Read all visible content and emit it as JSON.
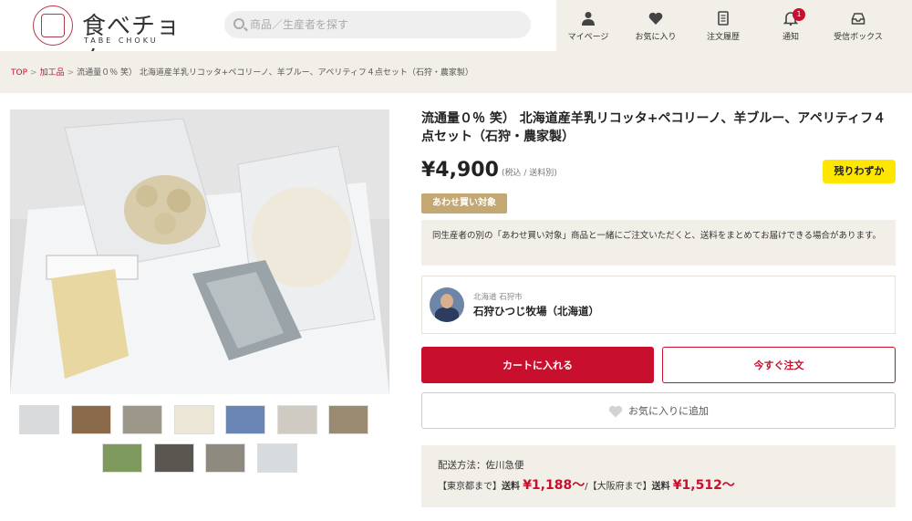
{
  "header": {
    "logo_text": "食べチョク",
    "logo_sub": "TABE CHOKU",
    "search_placeholder": "商品／生産者を探す",
    "nav": [
      {
        "label": "マイページ",
        "icon": "person-icon"
      },
      {
        "label": "お気に入り",
        "icon": "heart-icon"
      },
      {
        "label": "注文履歴",
        "icon": "receipt-icon"
      },
      {
        "label": "通知",
        "icon": "bell-icon",
        "badge": "1"
      },
      {
        "label": "受信ボックス",
        "icon": "inbox-icon"
      }
    ]
  },
  "breadcrumb": {
    "top": "TOP",
    "category": "加工品",
    "current": "流通量０％ 笑） 北海道産羊乳リコッタ+ペコリーノ、羊ブルー、アペリティフ４点セット（石狩・農家製）"
  },
  "product": {
    "title": "流通量０％ 笑） 北海道産羊乳リコッタ+ペコリーノ、羊ブルー、アペリティフ４点セット（石狩・農家製）",
    "price": "¥4,900",
    "price_note": "(税込 / 送料別)",
    "stock_badge": "残りわずか",
    "combo_tag": "あわせ買い対象",
    "combo_text": "同生産者の別の「あわせ買い対象」商品と一緒にご注文いただくと、送料をまとめてお届けできる場合があります。",
    "thumbnail_count": 11
  },
  "producer": {
    "location": "北海道 石狩市",
    "name": "石狩ひつじ牧場（北海道）"
  },
  "actions": {
    "cart": "カートに入れる",
    "order_now": "今すぐ注文",
    "favorite": "お気に入りに追加"
  },
  "shipping": {
    "method": "配送方法：佐川急便",
    "tokyo_label": "【東京都まで】",
    "fee_label": "送料",
    "tokyo_fee": "¥1,188〜",
    "separator": "/",
    "osaka_label": "【大阪府まで】",
    "osaka_fee": "¥1,512〜"
  },
  "colors": {
    "accent": "#c8102e",
    "beige": "#f2efe8",
    "gold_tag": "#c4a874",
    "yellow_badge": "#ffe600"
  }
}
